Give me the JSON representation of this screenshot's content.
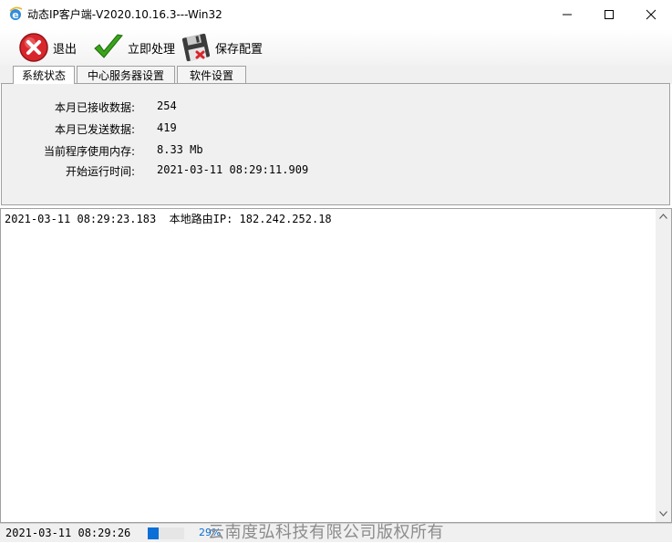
{
  "window": {
    "title": "动态IP客户端-V2020.10.16.3---Win32",
    "app_icon": "ie-e-icon",
    "controls": [
      "minimize-icon",
      "maximize-icon",
      "close-icon"
    ]
  },
  "toolbar": {
    "exit_label": "退出",
    "process_label": "立即处理",
    "save_label": "保存配置"
  },
  "tabs": [
    {
      "label": "系统状态",
      "active": true
    },
    {
      "label": "中心服务器设置",
      "active": false
    },
    {
      "label": "软件设置",
      "active": false
    }
  ],
  "status": {
    "rows": [
      {
        "label": "本月已接收数据:",
        "value": "254"
      },
      {
        "label": "本月已发送数据:",
        "value": "419"
      },
      {
        "label": "当前程序使用内存:",
        "value": "8.33 Mb"
      },
      {
        "label": "开始运行时间:",
        "value": "2021-03-11 08:29:11.909"
      }
    ]
  },
  "log": {
    "lines": [
      "2021-03-11 08:29:23.183  本地路由IP: 182.242.252.18"
    ]
  },
  "statusbar": {
    "time": "2021-03-11 08:29:26",
    "progress_text": "29%",
    "progress_fraction": 0.29,
    "copyright": "云南度弘科技有限公司版权所有"
  },
  "colors": {
    "accent": "#0a6fd6",
    "exit_red": "#d9262c",
    "check_green": "#3aa31a"
  }
}
